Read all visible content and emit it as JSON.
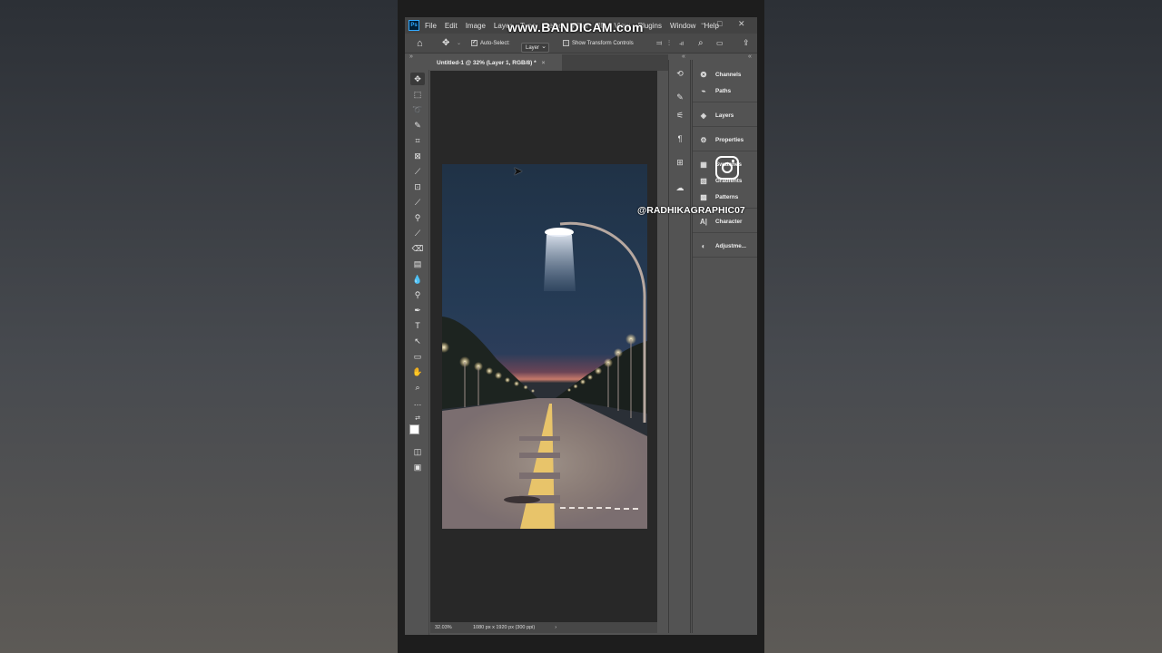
{
  "watermark": "www.BANDICAM.com",
  "app": {
    "logo": "Ps"
  },
  "menu": [
    "File",
    "Edit",
    "Image",
    "Layer",
    "Type",
    "Select",
    "Filter",
    "3D",
    "View",
    "Plugins",
    "Window",
    "Help"
  ],
  "window_controls": [
    "−",
    "□",
    "✕"
  ],
  "options": {
    "auto_select_label": "Auto-Select:",
    "auto_select_value": "Layer",
    "transform_label": "Show Transform Controls"
  },
  "document": {
    "tab_title": "Untitled-1 @ 32% (Layer 1, RGB/8) *",
    "close": "×",
    "zoom": "32.03%",
    "doc_info": "1080 px x 1920 px (300 ppi)"
  },
  "panels": [
    {
      "label": "Channels",
      "icon": "channels-icon"
    },
    {
      "label": "Paths",
      "icon": "paths-icon"
    },
    {
      "label": "Layers",
      "icon": "layers-icon"
    },
    {
      "label": "Properties",
      "icon": "properties-icon"
    },
    {
      "label": "Swatches",
      "icon": "swatches-icon"
    },
    {
      "label": "Gradients",
      "icon": "gradients-icon"
    },
    {
      "label": "Patterns",
      "icon": "patterns-icon"
    },
    {
      "label": "Character",
      "icon": "character-icon"
    },
    {
      "label": "Adjustme...",
      "icon": "adjustments-icon"
    }
  ],
  "overlay": {
    "handle": "@RADHIKAGRAPHIC07"
  },
  "colors": {
    "ps_accent": "#31a8ff",
    "ui_bg": "#535353",
    "canvas_bg": "#282828"
  }
}
